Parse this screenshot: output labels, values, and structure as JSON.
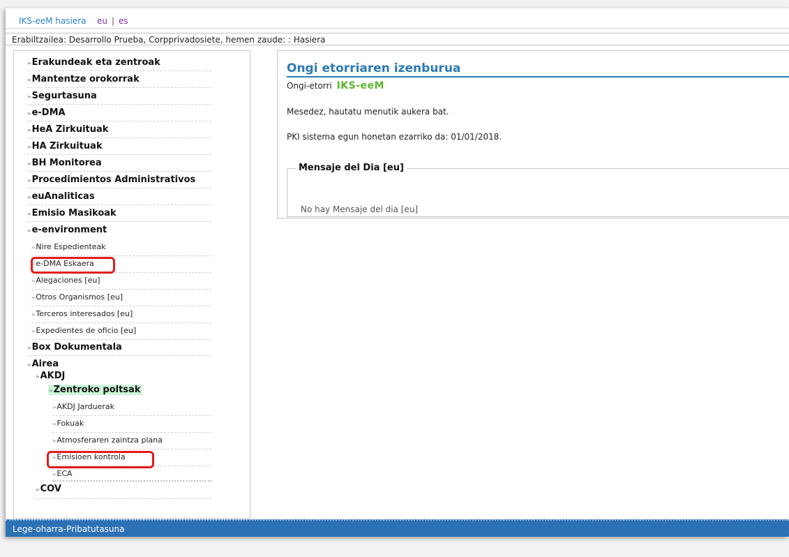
{
  "topbar": {
    "home_link": "IKS-eeM hasiera",
    "lang_eu": "eu",
    "lang_sep": "|",
    "lang_es": "es"
  },
  "userline": "Erabiltzailea: Desarrollo Prueba, Corpprivadosiete, hemen zaude: : Hasiera",
  "sidebar": {
    "arrow": "››",
    "items": [
      "Erakundeak eta zentroak",
      "Mantentze orokorrak",
      "Segurtasuna",
      "e-DMA",
      "HeA Zirkuituak",
      "HA Zirkuituak",
      "BH Monitorea",
      "Procedimientos Administrativos",
      "euAnaliticas",
      "Emisio Masikoak",
      "e-environment"
    ],
    "env_children": [
      "Nire Espedienteak",
      "e-DMA Eskaera",
      "Alegaciones [eu]",
      "Otros Organismos [eu]",
      "Terceros interesados [eu]",
      "Expedientes de oficio [eu]"
    ],
    "box": "Box Dokumentala",
    "airea": "Airea",
    "akdj": "AKDJ",
    "zentroko": "Zentroko poltsak",
    "akdj_children": [
      "AKDJ Jarduerak",
      "Fokuak",
      "Atmosferaren zaintza plana",
      "Emisioen kontrola",
      "ECA"
    ],
    "cov": "COV",
    "highlight_color": "#e11c1c"
  },
  "main": {
    "title": "Ongi etorriaren izenburua",
    "welcome": "Ongi-etorri",
    "logo_text": "IKS-eeM",
    "line1": "Mesedez, hautatu menutik aukera bat.",
    "line2": "PKI sistema egun honetan ezarriko da: 01/01/2018.",
    "msg_legend": "Mensaje del Dia [eu]",
    "msg_empty": "No hay Mensaje del dia [eu]"
  },
  "footer": {
    "text": "Lege-oharra-Pribatutasuna"
  },
  "colors": {
    "accent": "#2b7ab8",
    "footer_bg": "#2d71b5",
    "logo": "#5ab62e",
    "selected_bg": "#cdf5d7"
  }
}
